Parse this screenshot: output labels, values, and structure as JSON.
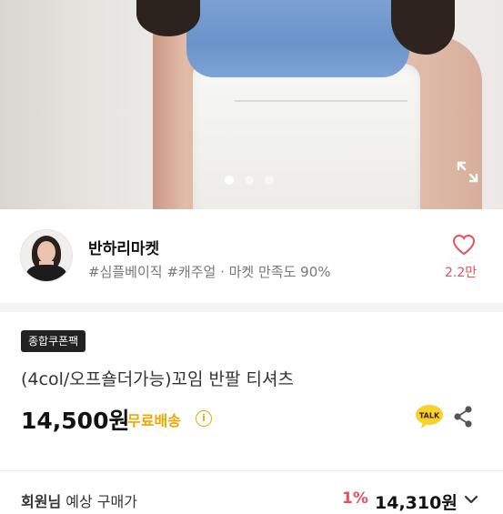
{
  "shop": {
    "name": "반하리마켓",
    "tags": "#심플베이직 #캐주얼 · 마켓 만족도 90%",
    "likes": "2.2만"
  },
  "carousel": {
    "total": 3,
    "current": 1
  },
  "product": {
    "badge": "종합쿠폰팩",
    "title": "(4col/오프숄더가능)꼬임 반팔 티셔츠",
    "price": "14,500원",
    "shipping": "무료배송",
    "talk_label": "TALK"
  },
  "member": {
    "label_bold": "회원님",
    "label_rest": " 예상 구매가",
    "discount": "1%",
    "price": "14,310원"
  },
  "colors": {
    "accent_red": "#e8505b",
    "shipping_yellow": "#f0a500",
    "talk_yellow": "#f7d22a"
  },
  "icons": [
    "expand-icon",
    "heart-icon",
    "info-icon",
    "kakao-talk-icon",
    "share-icon",
    "chevron-down-icon"
  ]
}
